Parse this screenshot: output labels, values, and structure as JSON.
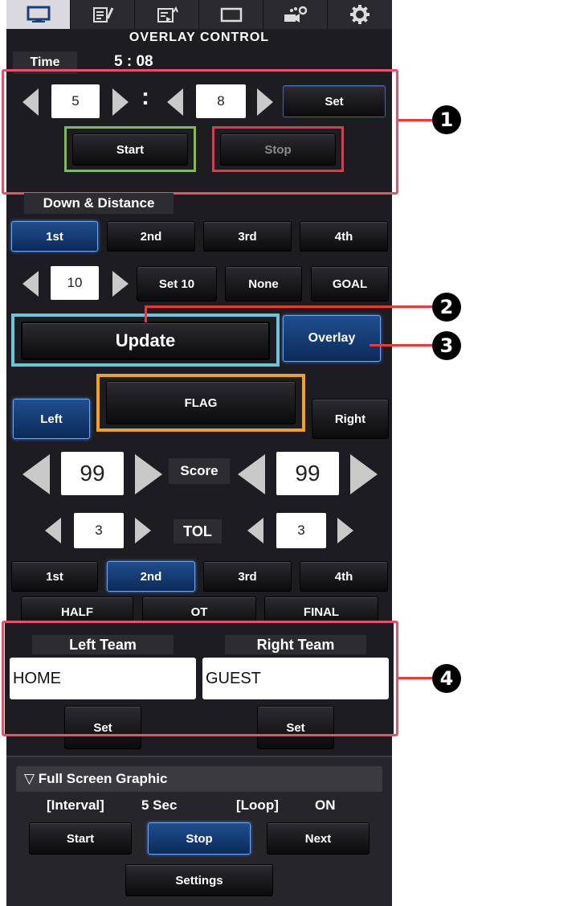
{
  "tabs": [
    {
      "icon": "monitor-icon"
    },
    {
      "icon": "notes-icon"
    },
    {
      "icon": "playlist-icon"
    },
    {
      "icon": "window-icon"
    },
    {
      "icon": "camera-gear-icon"
    },
    {
      "icon": "gear-icon"
    }
  ],
  "header": {
    "title": "OVERLAY CONTROL"
  },
  "time": {
    "label": "Time",
    "display": "5 : 08",
    "minutes": "5",
    "separator": ":",
    "seconds": "8",
    "set_label": "Set",
    "start_label": "Start",
    "stop_label": "Stop"
  },
  "down_distance": {
    "label": "Down & Distance",
    "downs": [
      "1st",
      "2nd",
      "3rd",
      "4th"
    ],
    "selected_down": "1st",
    "distance": "10",
    "set10_label": "Set 10",
    "none_label": "None",
    "goal_label": "GOAL"
  },
  "actions": {
    "update_label": "Update",
    "overlay_label": "Overlay"
  },
  "flag": {
    "left_label": "Left",
    "flag_label": "FLAG",
    "right_label": "Right"
  },
  "score": {
    "label": "Score",
    "left": "99",
    "right": "99"
  },
  "tol": {
    "label": "TOL",
    "left": "3",
    "right": "3"
  },
  "period": {
    "quarters": [
      "1st",
      "2nd",
      "3rd",
      "4th"
    ],
    "selected": "2nd",
    "states": [
      "HALF",
      "OT",
      "FINAL"
    ]
  },
  "teams": {
    "left_label": "Left Team",
    "right_label": "Right Team",
    "left_value": "HOME",
    "right_value": "GUEST",
    "set_label": "Set"
  },
  "fullscreen": {
    "header": "▽ Full Screen Graphic",
    "interval_label": "[Interval]",
    "interval_value": "5 Sec",
    "loop_label": "[Loop]",
    "loop_value": "ON",
    "start_label": "Start",
    "stop_label": "Stop",
    "next_label": "Next",
    "settings_label": "Settings"
  },
  "callouts": [
    "1",
    "2",
    "3",
    "4"
  ],
  "colors": {
    "panel": "#1d1d21",
    "callout_line": "#e53b3b",
    "start_highlight": "#7fbf3f",
    "stop_highlight": "#e8344f",
    "update_highlight": "#6cc6d9",
    "flag_highlight": "#f2a024",
    "active_blue": "#1f4f8e"
  }
}
